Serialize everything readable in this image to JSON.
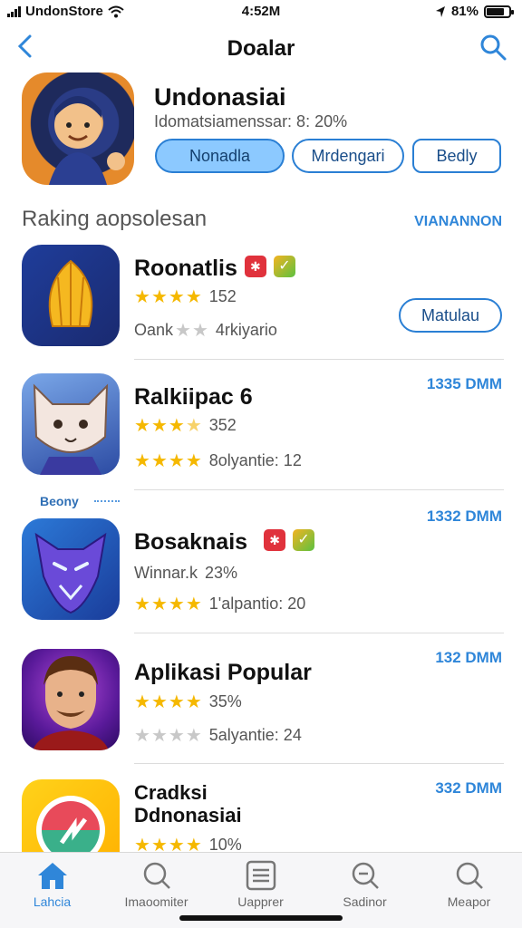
{
  "status_bar": {
    "carrier": "UndonStore",
    "time": "4:52M",
    "battery": "81%"
  },
  "nav": {
    "title": "Doalar"
  },
  "hero": {
    "name": "Undonasiai",
    "subtitle": "Idomatsiamenssar: 8: 20%",
    "buttons": [
      "Nonadla",
      "Mrdengari",
      "Bedly"
    ]
  },
  "section": {
    "title": "Raking aopsolesan",
    "link": "VIANANNON"
  },
  "apps": [
    {
      "name": "Roonatlis",
      "rating_text": "152",
      "rating": 4,
      "meta": "Oank",
      "meta_rating": 2,
      "meta_text": "4rkiyario",
      "action": "Matulau"
    },
    {
      "name": "Ralkiipac  6",
      "rating_text": "352",
      "rating": 3.5,
      "meta_text": "8olyantie: 12",
      "meta_rating": 4,
      "price": "1335 DMM"
    },
    {
      "name": "Bosaknais",
      "rating_text": "23%",
      "meta": "Winnar.k",
      "meta_text": "1'alpantio: 20",
      "meta_rating": 4,
      "price": "1332 DMM"
    },
    {
      "name": "Aplikasi Popular",
      "rating_text": "35%",
      "rating": 4,
      "meta_text": "5alyantie: 24",
      "meta_rating": 0,
      "price": "132 DMM"
    },
    {
      "name_line1": "Cradksi",
      "name_line2": "Ddnonasiai",
      "rating_text": "10%",
      "rating": 4,
      "price": "332 DMM"
    }
  ],
  "mini_label": "Beony",
  "tabs": [
    {
      "label": "Lahcia",
      "icon": "home-icon",
      "active": true
    },
    {
      "label": "Imaoomiter",
      "icon": "search-icon"
    },
    {
      "label": "Uapprer",
      "icon": "list-icon"
    },
    {
      "label": "Sadinor",
      "icon": "zoom-icon"
    },
    {
      "label": "Meapor",
      "icon": "search-icon"
    }
  ],
  "colors": {
    "accent": "#2f86d9",
    "star": "#f5b800",
    "primary_pill": "#8cc9ff"
  }
}
